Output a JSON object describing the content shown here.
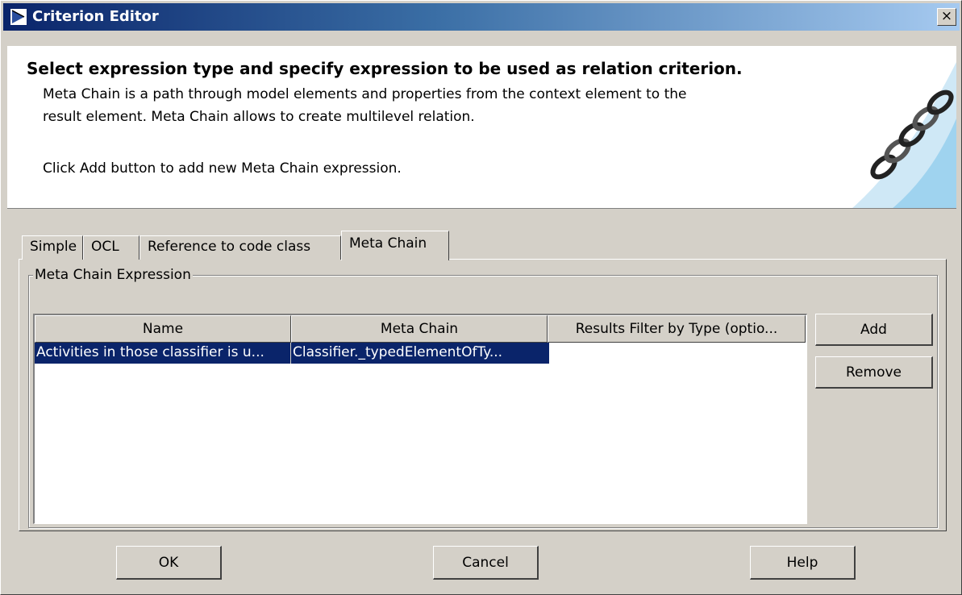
{
  "window": {
    "title": "Criterion Editor",
    "close_label": "×"
  },
  "header": {
    "heading": "Select expression type and specify expression to be used as relation criterion.",
    "line1": "Meta Chain is a path through model elements and properties from the context element to the",
    "line2": "result element. Meta Chain allows to create multilevel relation.",
    "line3": "Click Add button to add new Meta Chain expression."
  },
  "tabs": [
    {
      "label": "Simple"
    },
    {
      "label": "OCL"
    },
    {
      "label": "Reference to code class"
    },
    {
      "label": "Meta Chain",
      "active": true
    }
  ],
  "group": {
    "label": "Meta Chain Expression"
  },
  "table": {
    "columns": [
      "Name",
      "Meta Chain",
      "Results Filter by Type (optio..."
    ],
    "rows": [
      [
        "Activities in those classifier is u...",
        "Classifier._typedElementOfTy...",
        ""
      ]
    ]
  },
  "side_buttons": {
    "add": "Add",
    "remove": "Remove"
  },
  "footer": {
    "ok": "OK",
    "cancel": "Cancel",
    "help": "Help"
  },
  "colors": {
    "title_start": "#0a246a",
    "title_end": "#a6caf0",
    "selection": "#0a246a",
    "face": "#d4d0c8",
    "decor_light": "#cfe8f6",
    "decor_mid": "#9fd3ef"
  },
  "icons": {
    "app": "diagonal-arrow-icon",
    "close": "close-icon",
    "decor": "chain-icon"
  }
}
